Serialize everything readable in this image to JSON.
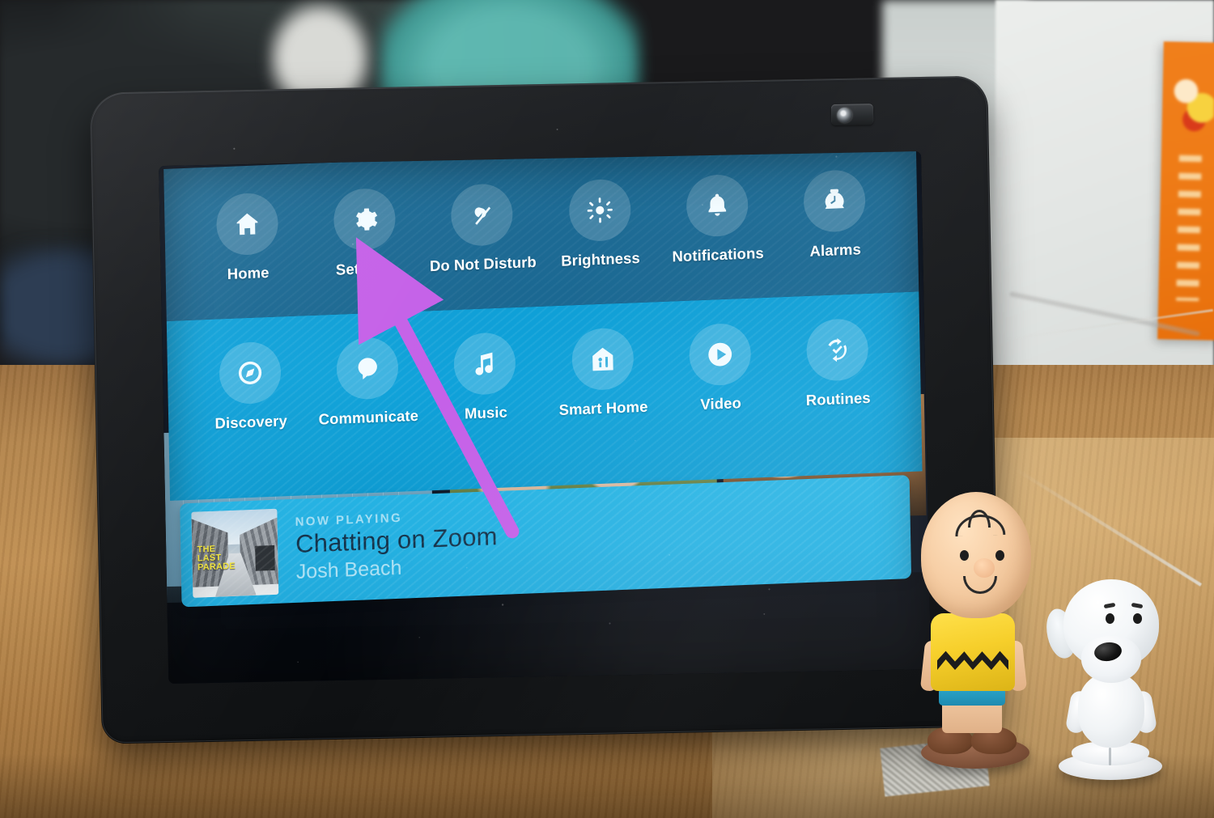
{
  "device": {
    "name": "smart-display",
    "camera_label": "camera"
  },
  "overlay": {
    "row1": [
      {
        "label": "Home",
        "icon": "home-icon"
      },
      {
        "label": "Settings",
        "icon": "gear-icon"
      },
      {
        "label": "Do Not Disturb",
        "icon": "do-not-disturb-icon"
      },
      {
        "label": "Brightness",
        "icon": "brightness-icon"
      },
      {
        "label": "Notifications",
        "icon": "bell-icon"
      },
      {
        "label": "Alarms",
        "icon": "alarm-clock-icon"
      }
    ],
    "row2": [
      {
        "label": "Discovery",
        "icon": "compass-icon"
      },
      {
        "label": "Communicate",
        "icon": "speech-bubble-icon"
      },
      {
        "label": "Music",
        "icon": "music-note-icon"
      },
      {
        "label": "Smart Home",
        "icon": "smart-home-icon"
      },
      {
        "label": "Video",
        "icon": "play-circle-icon"
      },
      {
        "label": "Routines",
        "icon": "routines-refresh-check-icon"
      }
    ],
    "now_playing": {
      "kicker": "NOW PLAYING",
      "title": "Chatting on Zoom",
      "artist": "Josh Beach",
      "album_art_text": "THE\nLAST\nPARADE"
    }
  },
  "annotation": {
    "arrow_target": "Settings",
    "arrow_color": "#c561e8"
  },
  "colors": {
    "panel_top": "#1d6b95",
    "panel_bottom": "#0fa2da",
    "now_playing_card": "#22b0e2",
    "label_text": "#ffffff",
    "now_playing_title": "#12324a",
    "arrow": "#c561e8"
  },
  "scene": {
    "figurines": [
      {
        "name": "charlie-brown-figurine"
      },
      {
        "name": "snoopy-figurine"
      }
    ],
    "surface": "wooden-desk",
    "wall_object": "orange-decorative-card"
  }
}
